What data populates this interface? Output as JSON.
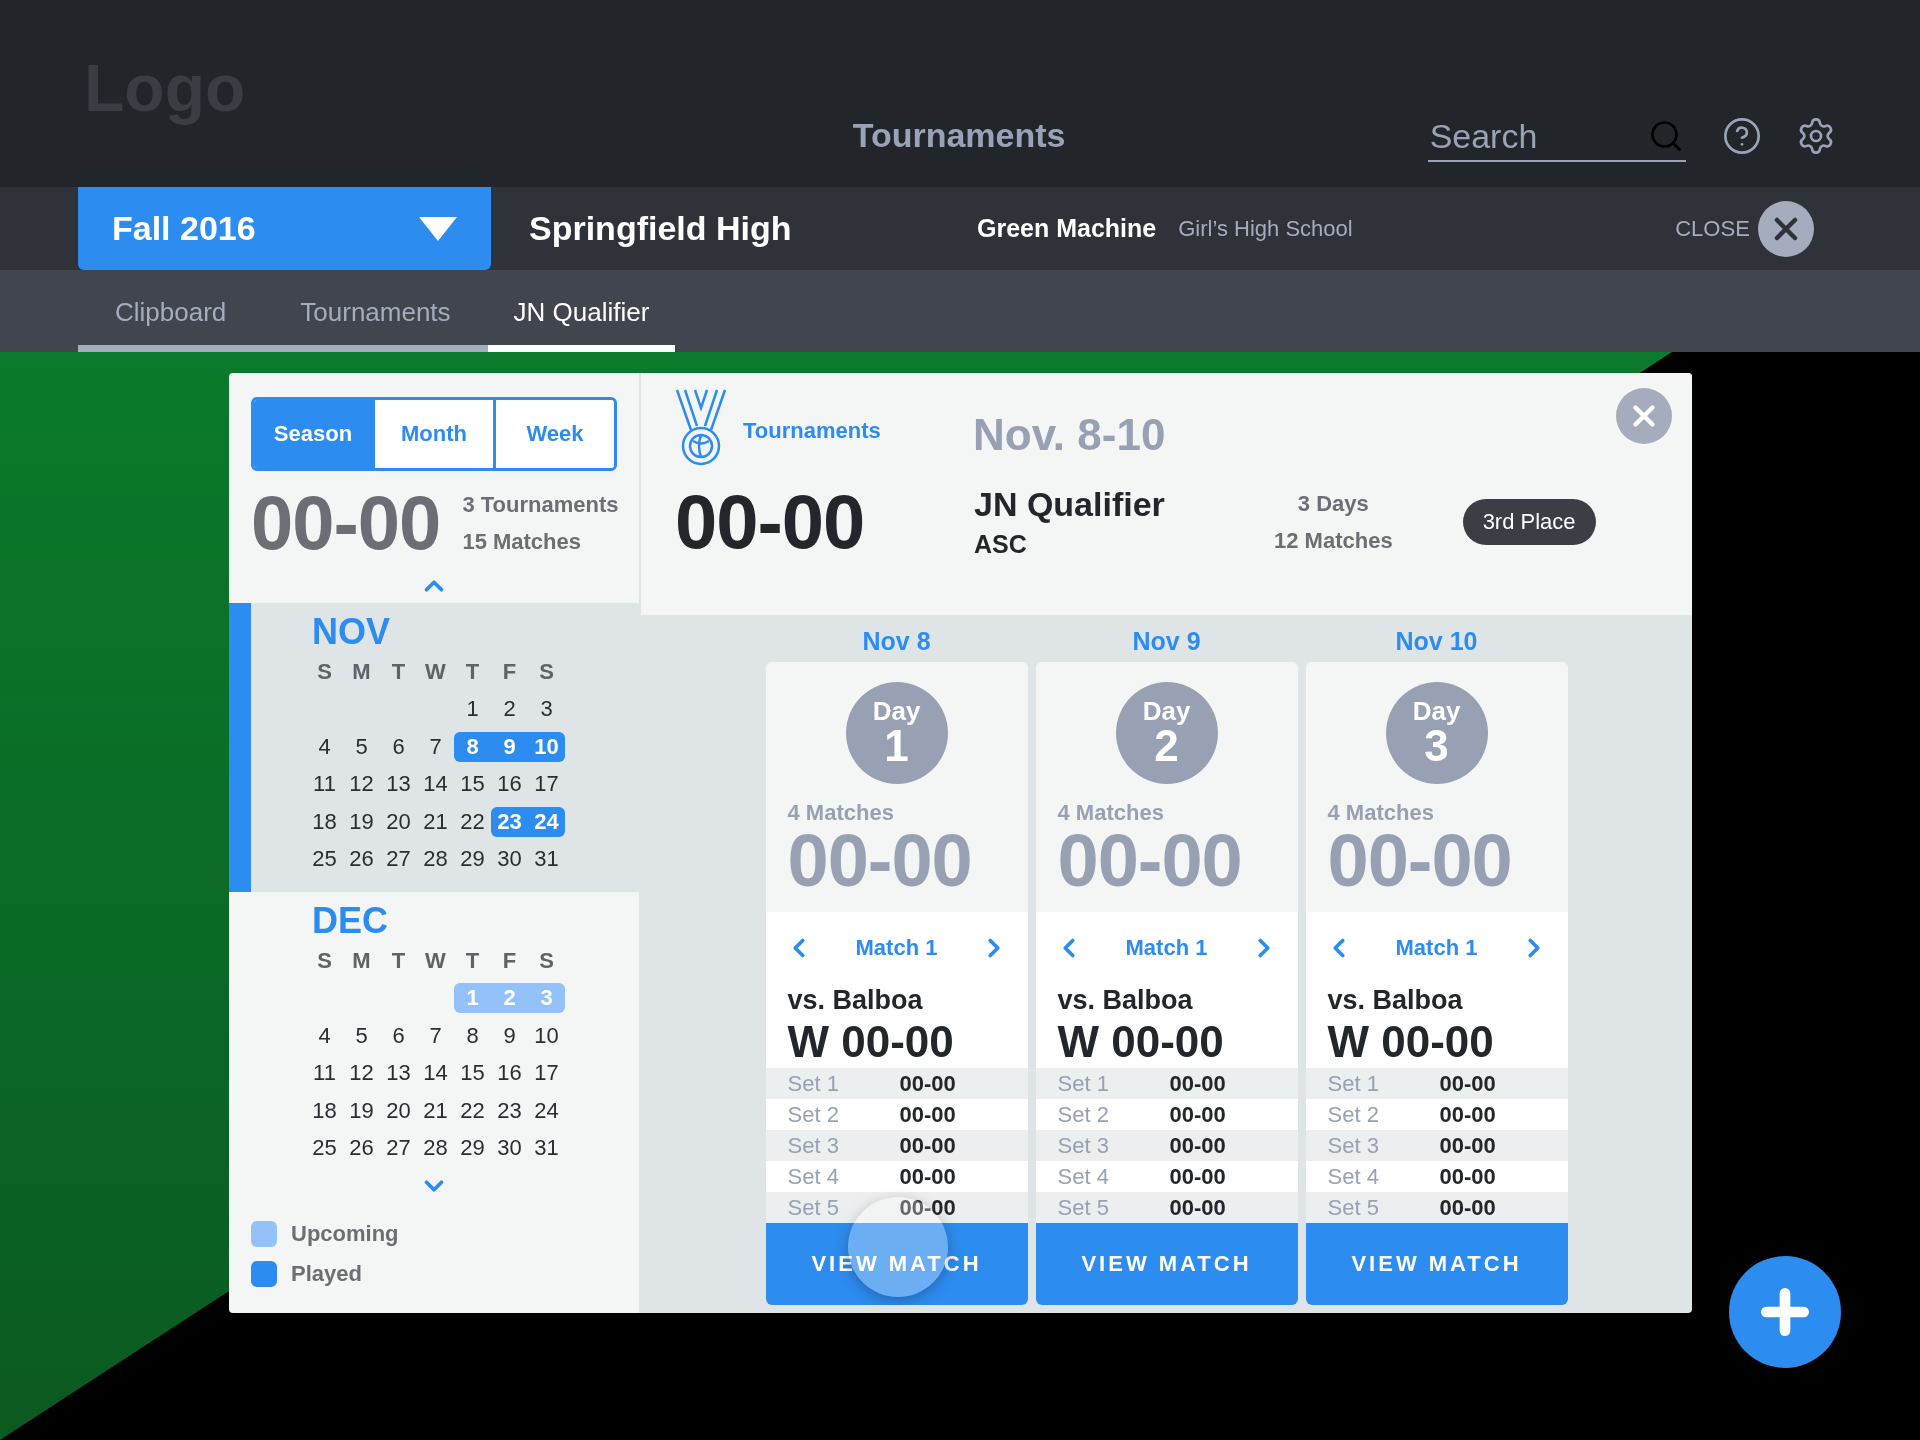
{
  "header": {
    "logo": "Logo",
    "title": "Tournaments",
    "search": {
      "placeholder": "Search"
    }
  },
  "context_bar": {
    "season": "Fall 2016",
    "school": "Springfield High",
    "team": "Green Machine",
    "division": "Girl’s High School",
    "close": "CLOSE"
  },
  "tabs": [
    {
      "label": "Clipboard",
      "selected": false
    },
    {
      "label": "Tournaments",
      "selected": false
    },
    {
      "label": "JN Qualifier",
      "selected": true
    }
  ],
  "sidebar": {
    "views": [
      {
        "label": "Season",
        "selected": true
      },
      {
        "label": "Month",
        "selected": false
      },
      {
        "label": "Week",
        "selected": false
      }
    ],
    "record": "00-00",
    "stats": [
      "3 Tournaments",
      "15 Matches"
    ],
    "months": [
      {
        "name": "NOV",
        "active": true,
        "weekdays": [
          "S",
          "M",
          "T",
          "W",
          "T",
          "F",
          "S"
        ],
        "weeks": [
          [
            {
              "d": "1"
            },
            {
              "d": "2"
            },
            {
              "d": "3"
            }
          ],
          [
            {
              "d": "4"
            },
            {
              "d": "5"
            },
            {
              "d": "6"
            },
            {
              "d": "7"
            },
            {
              "d": "8",
              "color": "#2d8cf0"
            },
            {
              "d": "9",
              "color": "#2d8cf0"
            },
            {
              "d": "10",
              "color": "#2d8cf0"
            }
          ],
          [
            {
              "d": "11"
            },
            {
              "d": "12"
            },
            {
              "d": "13"
            },
            {
              "d": "14"
            },
            {
              "d": "15"
            },
            {
              "d": "16"
            },
            {
              "d": "17"
            }
          ],
          [
            {
              "d": "18"
            },
            {
              "d": "19"
            },
            {
              "d": "20"
            },
            {
              "d": "21"
            },
            {
              "d": "22"
            },
            {
              "d": "23",
              "color": "#2d8cf0"
            },
            {
              "d": "24",
              "color": "#2d8cf0"
            }
          ],
          [
            {
              "d": "25"
            },
            {
              "d": "26"
            },
            {
              "d": "27"
            },
            {
              "d": "28"
            },
            {
              "d": "29"
            },
            {
              "d": "30"
            },
            {
              "d": "31"
            }
          ]
        ]
      },
      {
        "name": "DEC",
        "active": false,
        "weekdays": [
          "S",
          "M",
          "T",
          "W",
          "T",
          "F",
          "S"
        ],
        "weeks": [
          [
            {
              "d": "1",
              "color": "#93c2fb"
            },
            {
              "d": "2",
              "color": "#93c2fb"
            },
            {
              "d": "3",
              "color": "#93c2fb"
            }
          ],
          [
            {
              "d": "4"
            },
            {
              "d": "5"
            },
            {
              "d": "6"
            },
            {
              "d": "7"
            },
            {
              "d": "8"
            },
            {
              "d": "9"
            },
            {
              "d": "10"
            }
          ],
          [
            {
              "d": "11"
            },
            {
              "d": "12"
            },
            {
              "d": "13"
            },
            {
              "d": "14"
            },
            {
              "d": "15"
            },
            {
              "d": "16"
            },
            {
              "d": "17"
            }
          ],
          [
            {
              "d": "18"
            },
            {
              "d": "19"
            },
            {
              "d": "20"
            },
            {
              "d": "21"
            },
            {
              "d": "22"
            },
            {
              "d": "23"
            },
            {
              "d": "24"
            }
          ],
          [
            {
              "d": "25"
            },
            {
              "d": "26"
            },
            {
              "d": "27"
            },
            {
              "d": "28"
            },
            {
              "d": "29"
            },
            {
              "d": "30"
            },
            {
              "d": "31"
            }
          ]
        ]
      }
    ],
    "legend": [
      {
        "label": "Upcoming",
        "color": "#93c2fb"
      },
      {
        "label": "Played",
        "color": "#2d8cf0"
      }
    ]
  },
  "tournament": {
    "section": "Tournaments",
    "dates": "Nov. 8-10",
    "record": "00-00",
    "name": "JN Qualifier",
    "org": "ASC",
    "stats": [
      "3 Days",
      "12 Matches"
    ],
    "placement": "3rd Place",
    "days": [
      {
        "date": "Nov 8",
        "day_label": "Day",
        "day_number": "1",
        "matches": "4 Matches",
        "record": "00-00",
        "match": "Match 1",
        "opponent": "vs. Balboa",
        "result": "W 00-00",
        "touched": true,
        "sets": [
          {
            "label": "Set 1",
            "score": "00-00"
          },
          {
            "label": "Set 2",
            "score": "00-00"
          },
          {
            "label": "Set 3",
            "score": "00-00"
          },
          {
            "label": "Set 4",
            "score": "00-00"
          },
          {
            "label": "Set 5",
            "score": "00-00"
          }
        ],
        "button": "VIEW MATCH"
      },
      {
        "date": "Nov 9",
        "day_label": "Day",
        "day_number": "2",
        "matches": "4 Matches",
        "record": "00-00",
        "match": "Match 1",
        "opponent": "vs. Balboa",
        "result": "W 00-00",
        "touched": false,
        "sets": [
          {
            "label": "Set 1",
            "score": "00-00"
          },
          {
            "label": "Set 2",
            "score": "00-00"
          },
          {
            "label": "Set 3",
            "score": "00-00"
          },
          {
            "label": "Set 4",
            "score": "00-00"
          },
          {
            "label": "Set 5",
            "score": "00-00"
          }
        ],
        "button": "VIEW MATCH"
      },
      {
        "date": "Nov 10",
        "day_label": "Day",
        "day_number": "3",
        "matches": "4 Matches",
        "record": "00-00",
        "match": "Match 1",
        "opponent": "vs. Balboa",
        "result": "W 00-00",
        "touched": false,
        "sets": [
          {
            "label": "Set 1",
            "score": "00-00"
          },
          {
            "label": "Set 2",
            "score": "00-00"
          },
          {
            "label": "Set 3",
            "score": "00-00"
          },
          {
            "label": "Set 4",
            "score": "00-00"
          },
          {
            "label": "Set 5",
            "score": "00-00"
          }
        ],
        "button": "VIEW MATCH"
      }
    ]
  }
}
